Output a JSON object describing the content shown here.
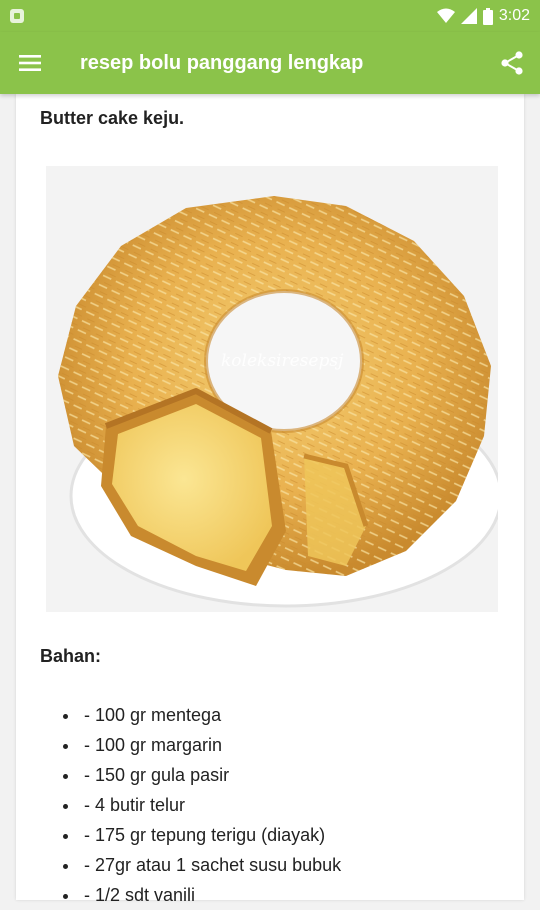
{
  "status_bar": {
    "time": "3:02"
  },
  "app_bar": {
    "title": "resep bolu panggang lengkap"
  },
  "article": {
    "heading": "Butter cake keju.",
    "image_watermark": "koleksiresepsj",
    "ingredients_heading": "Bahan:",
    "ingredients": [
      "- 100 gr mentega",
      "- 100 gr margarin",
      "- 150 gr gula pasir",
      "- 4 butir telur",
      "- 175 gr tepung terigu (diayak)",
      "- 27gr atau 1 sachet susu bubuk",
      "- 1/2 sdt vanili"
    ]
  },
  "colors": {
    "app_bar": "#8bc34a",
    "card": "#ffffff",
    "background": "#f2f2f2"
  },
  "icons": [
    "notification-icon",
    "wifi-icon",
    "signal-icon",
    "battery-icon",
    "menu-icon",
    "share-icon"
  ]
}
